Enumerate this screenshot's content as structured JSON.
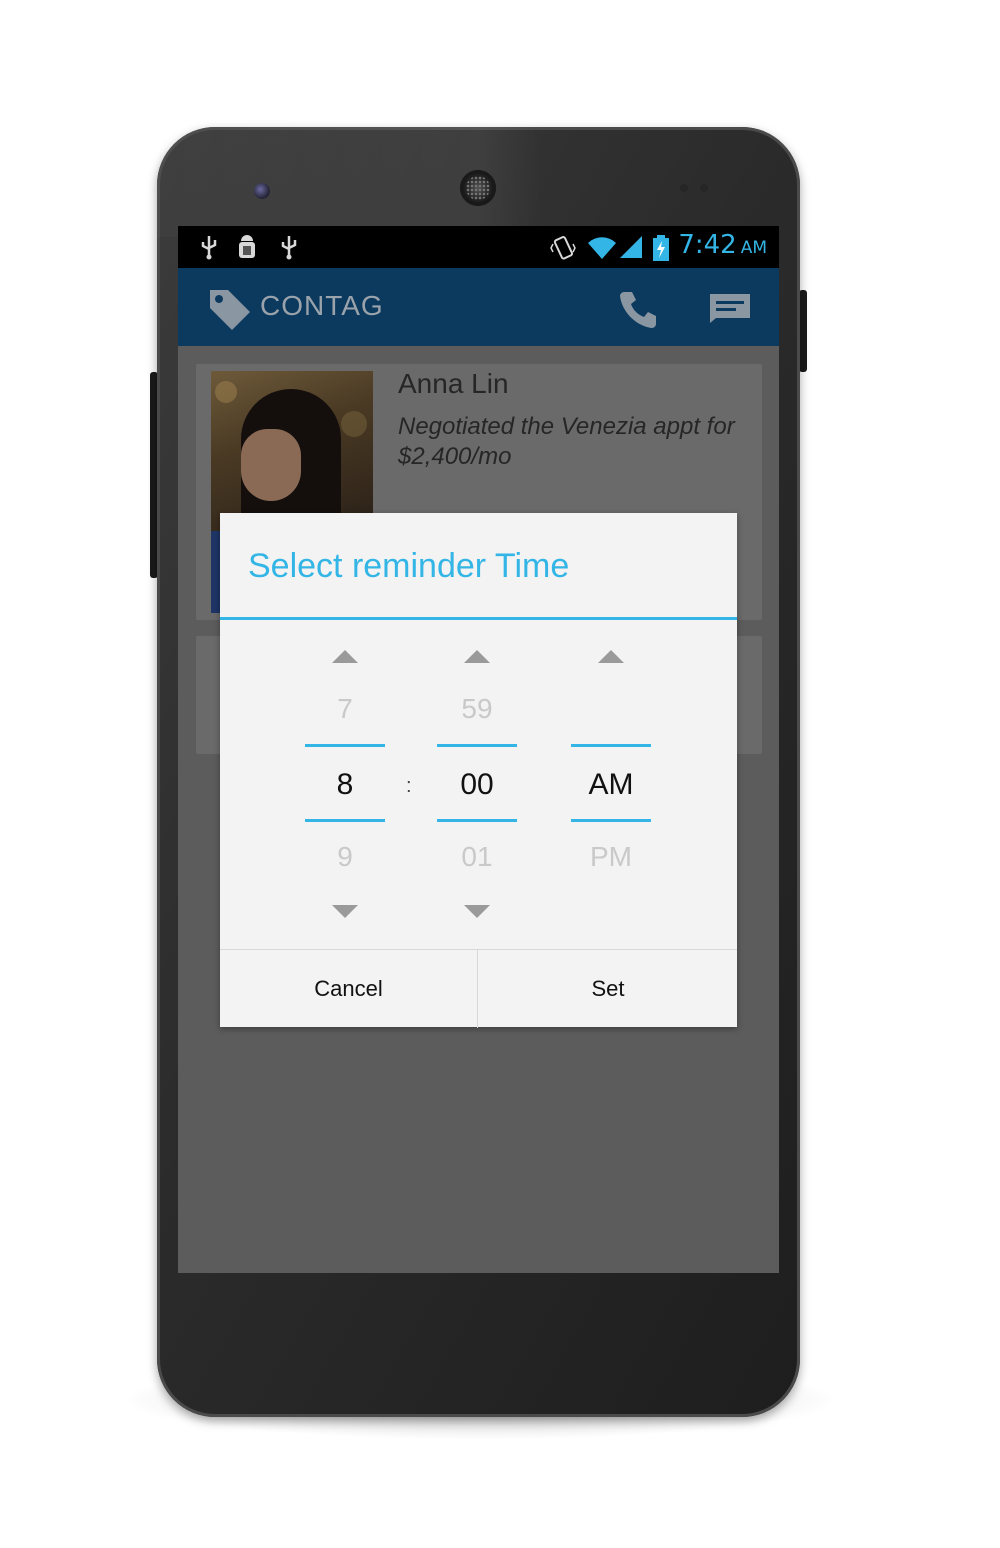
{
  "statusbar": {
    "time": "7:42",
    "ampm": "AM",
    "icons": [
      "usb-icon",
      "android-debug-icon",
      "usb-icon",
      "vibrate-icon",
      "wifi-icon",
      "signal-icon",
      "battery-charging-icon"
    ]
  },
  "actionbar": {
    "title": "CONTAG",
    "actions": [
      "phone-icon",
      "message-icon"
    ]
  },
  "contact": {
    "name": "Anna Lin",
    "note": "Negotiated the Venezia appt for $2,400/mo"
  },
  "dialog": {
    "title": "Select reminder Time",
    "hour": {
      "prev": "7",
      "current": "8",
      "next": "9"
    },
    "separator": ":",
    "minute": {
      "prev": "59",
      "current": "00",
      "next": "01"
    },
    "ampm": {
      "prev": "",
      "current": "AM",
      "next": "PM"
    },
    "cancel_label": "Cancel",
    "set_label": "Set"
  },
  "colors": {
    "accent": "#33b5e5",
    "actionbar": "#0c3a5f"
  }
}
